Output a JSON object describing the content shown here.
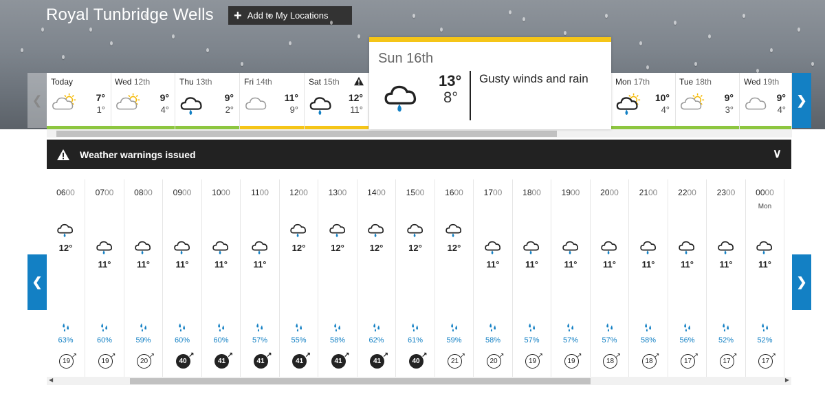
{
  "location": {
    "title": "Royal Tunbridge Wells",
    "add_button": "Add to My Locations"
  },
  "days": [
    {
      "name": "Today",
      "date": "",
      "hi": "7°",
      "lo": "1°",
      "icon": "sun-cloud-icon",
      "bar": "#8dc63f"
    },
    {
      "name": "Wed",
      "date": "12th",
      "hi": "9°",
      "lo": "4°",
      "icon": "sun-cloud-icon",
      "bar": "#8dc63f"
    },
    {
      "name": "Thu",
      "date": "13th",
      "hi": "9°",
      "lo": "2°",
      "icon": "cloud-rain-icon",
      "bar": "#8dc63f"
    },
    {
      "name": "Fri",
      "date": "14th",
      "hi": "11°",
      "lo": "9°",
      "icon": "cloud-icon",
      "bar": "#f5c518"
    },
    {
      "name": "Sat",
      "date": "15th",
      "hi": "12°",
      "lo": "11°",
      "icon": "cloud-rain-icon",
      "bar": "#f5c518",
      "warning": true
    },
    {
      "name": "Mon",
      "date": "17th",
      "hi": "10°",
      "lo": "4°",
      "icon": "sun-cloud-rain-icon",
      "bar": "#8dc63f"
    },
    {
      "name": "Tue",
      "date": "18th",
      "hi": "9°",
      "lo": "3°",
      "icon": "sun-cloud-icon",
      "bar": "#8dc63f"
    },
    {
      "name": "Wed",
      "date": "19th",
      "hi": "9°",
      "lo": "4°",
      "icon": "cloud-icon",
      "bar": "#8dc63f"
    }
  ],
  "selected_day": {
    "name": "Sun",
    "date": "16th",
    "hi": "13°",
    "lo": "8°",
    "description": "Gusty winds and rain",
    "icon": "cloud-rain-icon"
  },
  "warning_bar": {
    "text": "Weather warnings issued"
  },
  "hours": [
    {
      "h": "06",
      "m": "00",
      "temp": "12°",
      "rain": "63%",
      "wind": "19",
      "dark": false,
      "level": "high"
    },
    {
      "h": "07",
      "m": "00",
      "temp": "11°",
      "rain": "60%",
      "wind": "19",
      "dark": false,
      "level": "low"
    },
    {
      "h": "08",
      "m": "00",
      "temp": "11°",
      "rain": "59%",
      "wind": "20",
      "dark": false,
      "level": "low"
    },
    {
      "h": "09",
      "m": "00",
      "temp": "11°",
      "rain": "60%",
      "wind": "40",
      "dark": true,
      "level": "low"
    },
    {
      "h": "10",
      "m": "00",
      "temp": "11°",
      "rain": "60%",
      "wind": "41",
      "dark": true,
      "level": "low"
    },
    {
      "h": "11",
      "m": "00",
      "temp": "11°",
      "rain": "57%",
      "wind": "41",
      "dark": true,
      "level": "low"
    },
    {
      "h": "12",
      "m": "00",
      "temp": "12°",
      "rain": "55%",
      "wind": "41",
      "dark": true,
      "level": "high"
    },
    {
      "h": "13",
      "m": "00",
      "temp": "12°",
      "rain": "58%",
      "wind": "41",
      "dark": true,
      "level": "high"
    },
    {
      "h": "14",
      "m": "00",
      "temp": "12°",
      "rain": "62%",
      "wind": "41",
      "dark": true,
      "level": "high"
    },
    {
      "h": "15",
      "m": "00",
      "temp": "12°",
      "rain": "61%",
      "wind": "40",
      "dark": true,
      "level": "high"
    },
    {
      "h": "16",
      "m": "00",
      "temp": "12°",
      "rain": "59%",
      "wind": "21",
      "dark": false,
      "level": "high"
    },
    {
      "h": "17",
      "m": "00",
      "temp": "11°",
      "rain": "58%",
      "wind": "20",
      "dark": false,
      "level": "low"
    },
    {
      "h": "18",
      "m": "00",
      "temp": "11°",
      "rain": "57%",
      "wind": "19",
      "dark": false,
      "level": "low"
    },
    {
      "h": "19",
      "m": "00",
      "temp": "11°",
      "rain": "57%",
      "wind": "19",
      "dark": false,
      "level": "low"
    },
    {
      "h": "20",
      "m": "00",
      "temp": "11°",
      "rain": "57%",
      "wind": "18",
      "dark": false,
      "level": "low"
    },
    {
      "h": "21",
      "m": "00",
      "temp": "11°",
      "rain": "58%",
      "wind": "18",
      "dark": false,
      "level": "low"
    },
    {
      "h": "22",
      "m": "00",
      "temp": "11°",
      "rain": "56%",
      "wind": "17",
      "dark": false,
      "level": "low"
    },
    {
      "h": "23",
      "m": "00",
      "temp": "11°",
      "rain": "52%",
      "wind": "17",
      "dark": false,
      "level": "low"
    },
    {
      "h": "00",
      "m": "00",
      "temp": "11°",
      "rain": "52%",
      "wind": "17",
      "dark": false,
      "level": "low",
      "day_label": "Mon"
    }
  ],
  "colors": {
    "accent": "#1380c4",
    "warning_yellow": "#f5c518",
    "ok_green": "#8dc63f",
    "dark": "#222222"
  }
}
